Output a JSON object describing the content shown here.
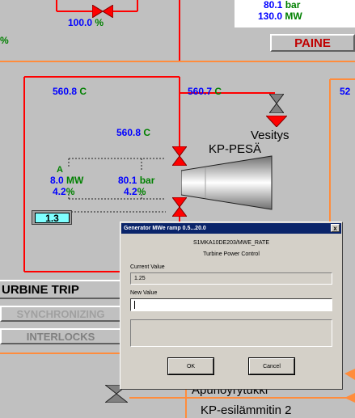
{
  "top": {
    "pct": "100.0",
    "pct_unit": "%",
    "bar_val": "80.1",
    "bar_unit": "bar",
    "mw_val": "130.0",
    "mw_unit": "MW",
    "left_pct": "%",
    "paine": "PAINE"
  },
  "mid": {
    "temp1": "560.8",
    "temp1_unit": "C",
    "temp2": "560.7",
    "temp2_unit": "C",
    "temp3": "560.8",
    "temp3_unit": "C",
    "right_val": "52",
    "vesitys": "Vesitys",
    "kp_pesa": "KP-PESÄ",
    "a": "A",
    "mw_val": "8.0",
    "mw_unit": "MW",
    "pct1": "4.2",
    "pct1_unit": "%",
    "bar_val": "80.1",
    "bar_unit": "bar",
    "pct2": "4.2",
    "pct2_unit": "%",
    "setpoint": "1.3"
  },
  "buttons": {
    "turbine_trip": "URBINE TRIP",
    "synchronizing": "SYNCHRONIZING",
    "interlocks": "INTERLOCKS"
  },
  "bottom": {
    "apuhoyrytukki": "Apuhöyrytukki",
    "esilammitin": "KP-esilämmitin 2"
  },
  "dialog": {
    "title": "Generator MWe ramp 0.5...20.0",
    "close": "x",
    "tag": "S1MKA10DE203/MWE_RATE",
    "desc": "Turbine Power Control",
    "current_label": "Current Value",
    "current_value": "1.25",
    "new_label": "New Value",
    "new_value": "",
    "ok": "OK",
    "cancel": "Cancel"
  },
  "colors": {
    "background": "#c0c0c0",
    "pipe_red": "#ff0000",
    "pipe_orange": "#ff8c3c",
    "value_blue": "#0000ff",
    "unit_green": "#008000",
    "dialog_title": "#0a246a"
  }
}
